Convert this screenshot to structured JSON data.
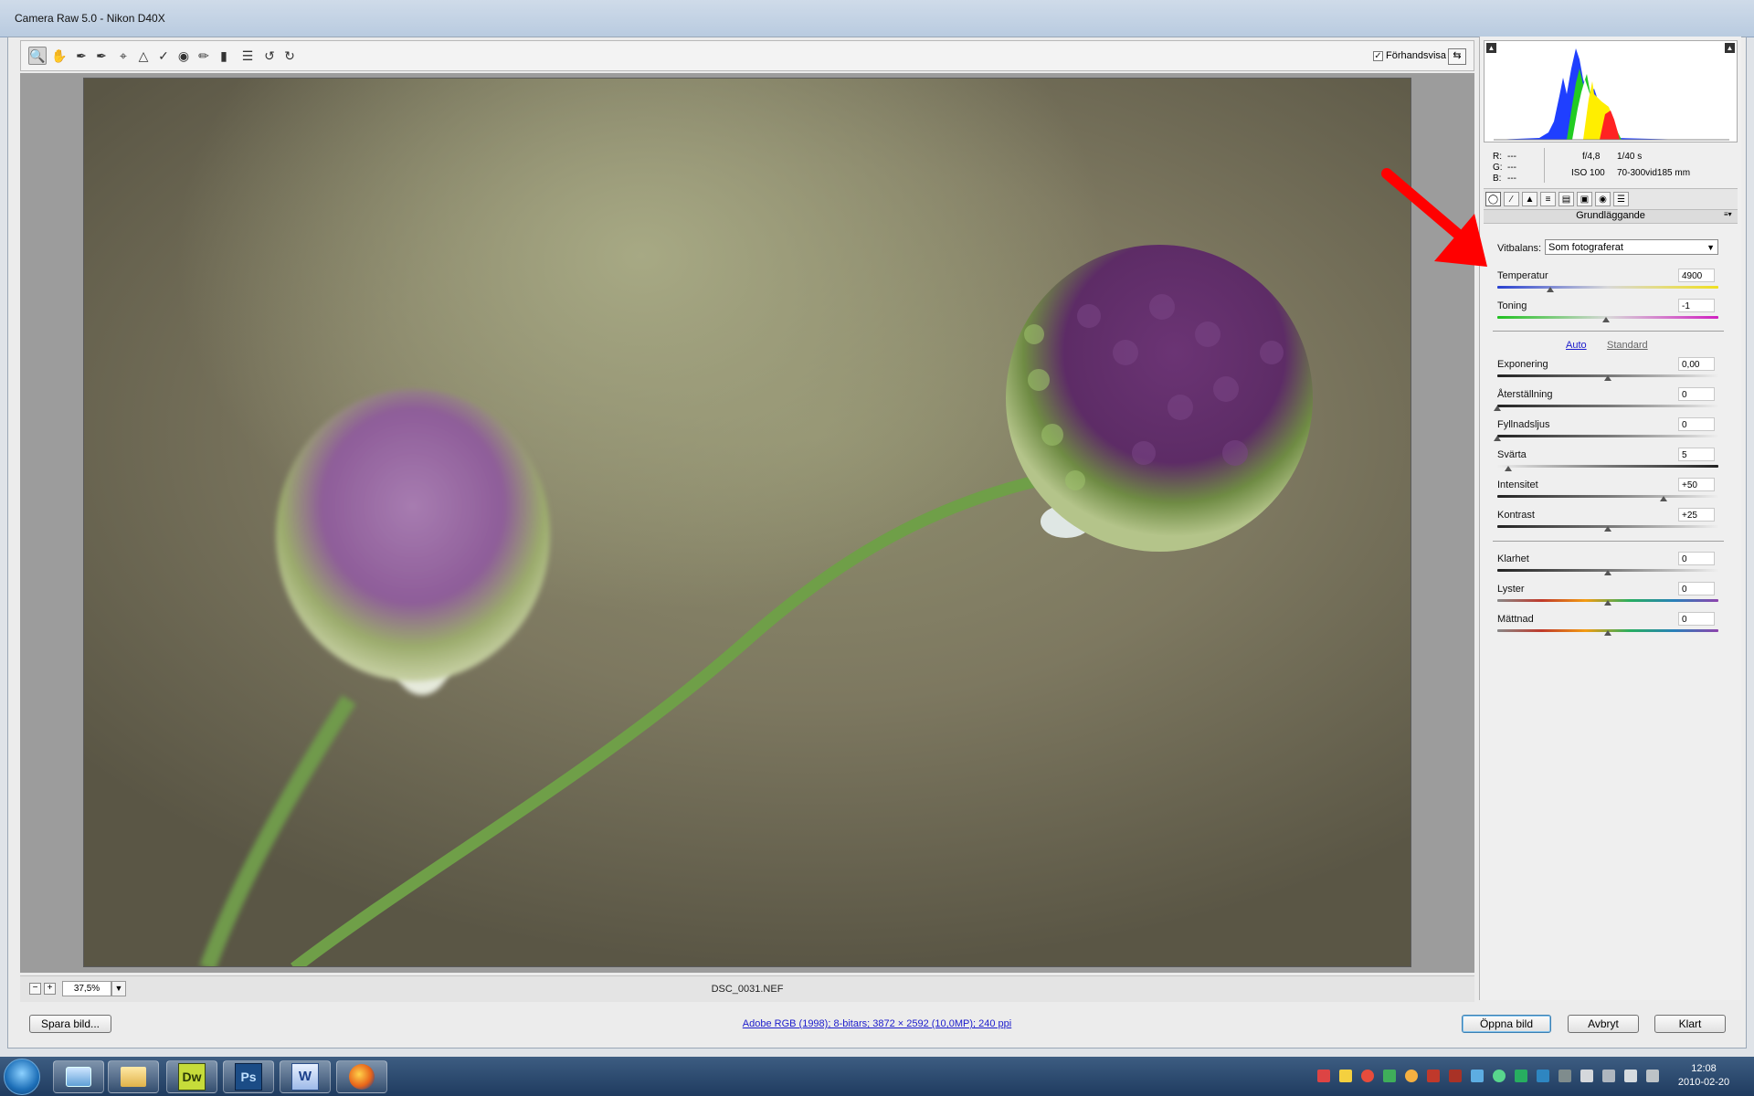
{
  "window": {
    "title": "Camera Raw 5.0  -  Nikon D40X"
  },
  "toolbar": {
    "tools": [
      "zoom-tool-icon",
      "hand-tool-icon",
      "white-balance-tool-icon",
      "color-sampler-tool-icon",
      "crop-tool-icon",
      "straighten-tool-icon",
      "spot-removal-tool-icon",
      "red-eye-tool-icon",
      "adjustment-brush-icon",
      "graduated-filter-icon",
      "preferences-icon",
      "rotate-left-icon",
      "rotate-right-icon"
    ],
    "preview_label": "Förhandsvisa",
    "preview_checked": true
  },
  "image": {
    "filename": "DSC_0031.NEF"
  },
  "zoom": {
    "value": "37,5%"
  },
  "metadata": {
    "r_label": "R:",
    "r_value": "---",
    "g_label": "G:",
    "g_value": "---",
    "b_label": "B:",
    "b_value": "---",
    "aperture": "f/4,8",
    "shutter": "1/40 s",
    "iso": "ISO 100",
    "lens": "70-300vid185 mm"
  },
  "panel": {
    "section_title": "Grundläggande",
    "white_balance_label": "Vitbalans:",
    "white_balance_value": "Som fotograferat",
    "auto_label": "Auto",
    "standard_label": "Standard",
    "sliders": [
      {
        "label": "Temperatur",
        "value": "4900",
        "pos": 0.24
      },
      {
        "label": "Toning",
        "value": "-1",
        "pos": 0.49
      },
      {
        "label": "Exponering",
        "value": "0,00",
        "pos": 0.5
      },
      {
        "label": "Återställning",
        "value": "0",
        "pos": 0.0
      },
      {
        "label": "Fyllnadsljus",
        "value": "0",
        "pos": 0.0
      },
      {
        "label": "Svärta",
        "value": "5",
        "pos": 0.05
      },
      {
        "label": "Intensitet",
        "value": "+50",
        "pos": 0.75
      },
      {
        "label": "Kontrast",
        "value": "+25",
        "pos": 0.5
      },
      {
        "label": "Klarhet",
        "value": "0",
        "pos": 0.5
      },
      {
        "label": "Lyster",
        "value": "0",
        "pos": 0.5
      },
      {
        "label": "Mättnad",
        "value": "0",
        "pos": 0.5
      }
    ]
  },
  "footer": {
    "save_label": "Spara bild...",
    "workflow_link": "Adobe RGB (1998); 8-bitars; 3872 × 2592 (10,0MP); 240 ppi",
    "open_label": "Öppna bild",
    "cancel_label": "Avbryt",
    "done_label": "Klart"
  },
  "taskbar": {
    "apps": [
      "explorer-icon",
      "folder-icon",
      "dreamweaver-icon",
      "photoshop-icon",
      "word-icon",
      "firefox-icon"
    ],
    "dw_label": "Dw",
    "ps_label": "Ps",
    "word_label": "W",
    "clock_time": "12:08",
    "clock_date": "2010-02-20"
  },
  "colors": {
    "annotation_arrow": "#ff0000",
    "accent_link": "#1c1ccc"
  }
}
